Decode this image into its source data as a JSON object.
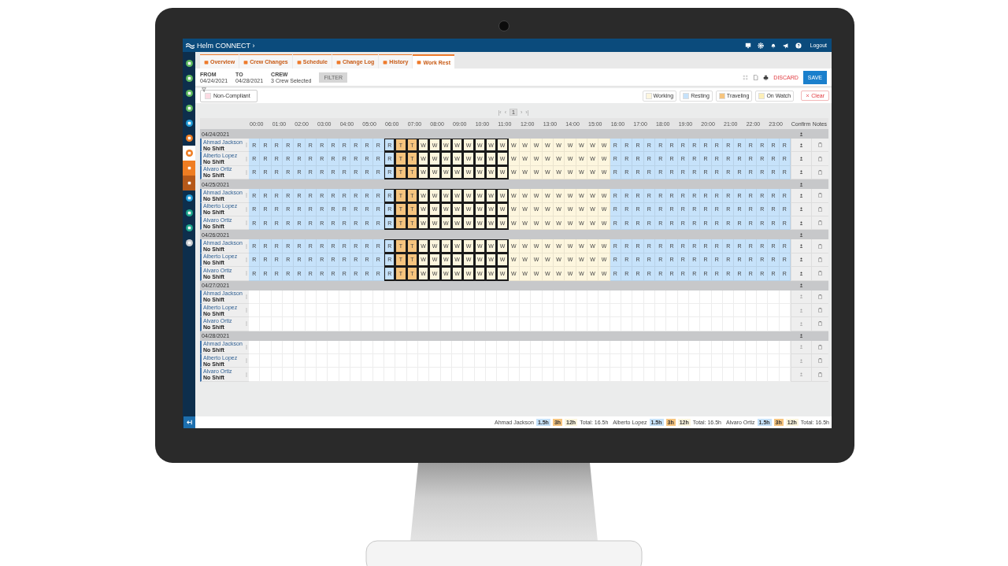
{
  "top_bar": {
    "brand": "Helm **CONNECT** ›",
    "logout": "Logout"
  },
  "sidebar": {
    "items": [
      {
        "color": "#5cb85c",
        "selected": false,
        "kind": "circle"
      },
      {
        "color": "#5cb85c",
        "selected": false,
        "kind": "circle"
      },
      {
        "color": "#5cb85c",
        "selected": false,
        "kind": "circle"
      },
      {
        "color": "#5cb85c",
        "selected": false,
        "kind": "circle"
      },
      {
        "color": "#1e9ad6",
        "selected": false,
        "kind": "circle"
      },
      {
        "color": "#ef7d22",
        "selected": false,
        "kind": "circle"
      },
      {
        "color": "#ef7d22",
        "selected": true,
        "kind": "circle"
      },
      {
        "color": "#ef7d22",
        "selected": false,
        "kind": "tile"
      },
      {
        "color": "#b5591a",
        "selected": false,
        "kind": "tile"
      },
      {
        "color": "#1e9ad6",
        "selected": false,
        "kind": "circle"
      },
      {
        "color": "#1aa58a",
        "selected": false,
        "kind": "circle"
      },
      {
        "color": "#1aa58a",
        "selected": false,
        "kind": "circle"
      },
      {
        "color": "#c9ccd0",
        "selected": false,
        "kind": "circle"
      }
    ]
  },
  "tabs": [
    {
      "label": "Overview",
      "selected": false
    },
    {
      "label": "Crew Changes",
      "selected": false
    },
    {
      "label": "Schedule",
      "selected": false
    },
    {
      "label": "Change Log",
      "selected": false
    },
    {
      "label": "History",
      "selected": false
    },
    {
      "label": "Work Rest",
      "selected": true
    }
  ],
  "filters": {
    "fields": [
      {
        "label": "FROM",
        "value": "04/24/2021"
      },
      {
        "label": "TO",
        "value": "04/28/2021"
      },
      {
        "label": "CREW",
        "value": "3 Crew Selected"
      }
    ],
    "filter_button": {
      "label": "FILTER",
      "disabled": true
    },
    "discard": "DISCARD",
    "save": "SAVE"
  },
  "legend": {
    "non_compliant": "Non-Compliant",
    "items": [
      {
        "label": "Working",
        "color": "#fdf6de"
      },
      {
        "label": "Resting",
        "color": "#c6e2fa"
      },
      {
        "label": "Traveling",
        "color": "#f6c47e"
      },
      {
        "label": "On Watch",
        "color": "#fcefb8"
      }
    ],
    "clear": "Clear"
  },
  "pagination": {
    "first": "|‹",
    "prev": "‹",
    "pages": [
      {
        "label": "1",
        "selected": true
      }
    ],
    "next": "›",
    "last": "›|"
  },
  "grid": {
    "hours": [
      "00:00",
      "01:00",
      "02:00",
      "03:00",
      "04:00",
      "05:00",
      "06:00",
      "07:00",
      "08:00",
      "09:00",
      "10:00",
      "11:00",
      "12:00",
      "13:00",
      "14:00",
      "15:00",
      "16:00",
      "17:00",
      "18:00",
      "19:00",
      "20:00",
      "21:00",
      "22:00",
      "23:00"
    ],
    "confirm": "Confirm",
    "notes": "Notes",
    "days": [
      {
        "date": "04/24/2021",
        "crew": [
          {
            "name": "Ahmad Jackson",
            "shift": "No Shift",
            "confirmable": true,
            "segments": [
              {
                "kind": "resting",
                "outlined": false,
                "cells": [
                  "R",
                  "R",
                  "R",
                  "R",
                  "R",
                  "R",
                  "R",
                  "R",
                  "R",
                  "R",
                  "R",
                  "R"
                ]
              },
              {
                "kind": "resting",
                "outlined": true,
                "cells": [
                  "R"
                ]
              },
              {
                "kind": "traveling",
                "outlined": true,
                "cells": [
                  "T",
                  "T"
                ]
              },
              {
                "kind": "working",
                "outlined": true,
                "cells": [
                  "W",
                  "W",
                  "W",
                  "W",
                  "W",
                  "W",
                  "W",
                  "W"
                ]
              },
              {
                "kind": "working",
                "outlined": false,
                "cells": [
                  "W",
                  "W",
                  "W",
                  "W",
                  "W",
                  "W",
                  "W",
                  "W",
                  "W"
                ]
              },
              {
                "kind": "resting",
                "outlined": false,
                "cells": [
                  "R",
                  "R",
                  "R",
                  "R",
                  "R",
                  "R",
                  "R",
                  "R",
                  "R",
                  "R",
                  "R",
                  "R",
                  "R",
                  "R",
                  "R",
                  "R"
                ]
              }
            ]
          },
          {
            "name": "Alberto Lopez",
            "shift": "No Shift",
            "confirmable": true,
            "segments": [
              {
                "kind": "resting",
                "outlined": false,
                "cells": [
                  "R",
                  "R",
                  "R",
                  "R",
                  "R",
                  "R",
                  "R",
                  "R",
                  "R",
                  "R",
                  "R",
                  "R"
                ]
              },
              {
                "kind": "resting",
                "outlined": true,
                "cells": [
                  "R"
                ]
              },
              {
                "kind": "traveling",
                "outlined": true,
                "cells": [
                  "T",
                  "T"
                ]
              },
              {
                "kind": "working",
                "outlined": true,
                "cells": [
                  "W",
                  "W",
                  "W",
                  "W",
                  "W",
                  "W",
                  "W",
                  "W"
                ]
              },
              {
                "kind": "working",
                "outlined": false,
                "cells": [
                  "W",
                  "W",
                  "W",
                  "W",
                  "W",
                  "W",
                  "W",
                  "W",
                  "W"
                ]
              },
              {
                "kind": "resting",
                "outlined": false,
                "cells": [
                  "R",
                  "R",
                  "R",
                  "R",
                  "R",
                  "R",
                  "R",
                  "R",
                  "R",
                  "R",
                  "R",
                  "R",
                  "R",
                  "R",
                  "R",
                  "R"
                ]
              }
            ]
          },
          {
            "name": "Alvaro Ortiz",
            "shift": "No Shift",
            "confirmable": true,
            "segments": [
              {
                "kind": "resting",
                "outlined": false,
                "cells": [
                  "R",
                  "R",
                  "R",
                  "R",
                  "R",
                  "R",
                  "R",
                  "R",
                  "R",
                  "R",
                  "R",
                  "R"
                ]
              },
              {
                "kind": "resting",
                "outlined": true,
                "cells": [
                  "R"
                ]
              },
              {
                "kind": "traveling",
                "outlined": true,
                "cells": [
                  "T",
                  "T"
                ]
              },
              {
                "kind": "working",
                "outlined": true,
                "cells": [
                  "W",
                  "W",
                  "W",
                  "W",
                  "W",
                  "W",
                  "W",
                  "W"
                ]
              },
              {
                "kind": "working",
                "outlined": false,
                "cells": [
                  "W",
                  "W",
                  "W",
                  "W",
                  "W",
                  "W",
                  "W",
                  "W",
                  "W"
                ]
              },
              {
                "kind": "resting",
                "outlined": false,
                "cells": [
                  "R",
                  "R",
                  "R",
                  "R",
                  "R",
                  "R",
                  "R",
                  "R",
                  "R",
                  "R",
                  "R",
                  "R",
                  "R",
                  "R",
                  "R",
                  "R"
                ]
              }
            ]
          }
        ]
      },
      {
        "date": "04/25/2021",
        "crew": [
          {
            "name": "Ahmad Jackson",
            "shift": "No Shift",
            "confirmable": true,
            "segments": [
              {
                "kind": "resting",
                "outlined": false,
                "cells": [
                  "R",
                  "R",
                  "R",
                  "R",
                  "R",
                  "R",
                  "R",
                  "R",
                  "R",
                  "R",
                  "R",
                  "R"
                ]
              },
              {
                "kind": "resting",
                "outlined": true,
                "cells": [
                  "R"
                ]
              },
              {
                "kind": "traveling",
                "outlined": true,
                "cells": [
                  "T",
                  "T"
                ]
              },
              {
                "kind": "working",
                "outlined": true,
                "cells": [
                  "W",
                  "W",
                  "W",
                  "W",
                  "W",
                  "W",
                  "W",
                  "W"
                ]
              },
              {
                "kind": "working",
                "outlined": false,
                "cells": [
                  "W",
                  "W",
                  "W",
                  "W",
                  "W",
                  "W",
                  "W",
                  "W",
                  "W"
                ]
              },
              {
                "kind": "resting",
                "outlined": false,
                "cells": [
                  "R",
                  "R",
                  "R",
                  "R",
                  "R",
                  "R",
                  "R",
                  "R",
                  "R",
                  "R",
                  "R",
                  "R",
                  "R",
                  "R",
                  "R",
                  "R"
                ]
              }
            ]
          },
          {
            "name": "Alberto Lopez",
            "shift": "No Shift",
            "confirmable": true,
            "segments": [
              {
                "kind": "resting",
                "outlined": false,
                "cells": [
                  "R",
                  "R",
                  "R",
                  "R",
                  "R",
                  "R",
                  "R",
                  "R",
                  "R",
                  "R",
                  "R",
                  "R"
                ]
              },
              {
                "kind": "resting",
                "outlined": true,
                "cells": [
                  "R"
                ]
              },
              {
                "kind": "traveling",
                "outlined": true,
                "cells": [
                  "T",
                  "T"
                ]
              },
              {
                "kind": "working",
                "outlined": true,
                "cells": [
                  "W",
                  "W",
                  "W",
                  "W",
                  "W",
                  "W",
                  "W",
                  "W"
                ]
              },
              {
                "kind": "working",
                "outlined": false,
                "cells": [
                  "W",
                  "W",
                  "W",
                  "W",
                  "W",
                  "W",
                  "W",
                  "W",
                  "W"
                ]
              },
              {
                "kind": "resting",
                "outlined": false,
                "cells": [
                  "R",
                  "R",
                  "R",
                  "R",
                  "R",
                  "R",
                  "R",
                  "R",
                  "R",
                  "R",
                  "R",
                  "R",
                  "R",
                  "R",
                  "R",
                  "R"
                ]
              }
            ]
          },
          {
            "name": "Alvaro Ortiz",
            "shift": "No Shift",
            "confirmable": true,
            "segments": [
              {
                "kind": "resting",
                "outlined": false,
                "cells": [
                  "R",
                  "R",
                  "R",
                  "R",
                  "R",
                  "R",
                  "R",
                  "R",
                  "R",
                  "R",
                  "R",
                  "R"
                ]
              },
              {
                "kind": "resting",
                "outlined": true,
                "cells": [
                  "R"
                ]
              },
              {
                "kind": "traveling",
                "outlined": true,
                "cells": [
                  "T",
                  "T"
                ]
              },
              {
                "kind": "working",
                "outlined": true,
                "cells": [
                  "W",
                  "W",
                  "W",
                  "W",
                  "W",
                  "W",
                  "W",
                  "W"
                ]
              },
              {
                "kind": "working",
                "outlined": false,
                "cells": [
                  "W",
                  "W",
                  "W",
                  "W",
                  "W",
                  "W",
                  "W",
                  "W",
                  "W"
                ]
              },
              {
                "kind": "resting",
                "outlined": false,
                "cells": [
                  "R",
                  "R",
                  "R",
                  "R",
                  "R",
                  "R",
                  "R",
                  "R",
                  "R",
                  "R",
                  "R",
                  "R",
                  "R",
                  "R",
                  "R",
                  "R"
                ]
              }
            ]
          }
        ]
      },
      {
        "date": "04/26/2021",
        "crew": [
          {
            "name": "Ahmad Jackson",
            "shift": "No Shift",
            "confirmable": true,
            "segments": [
              {
                "kind": "resting",
                "outlined": false,
                "cells": [
                  "R",
                  "R",
                  "R",
                  "R",
                  "R",
                  "R",
                  "R",
                  "R",
                  "R",
                  "R",
                  "R",
                  "R"
                ]
              },
              {
                "kind": "resting",
                "outlined": true,
                "cells": [
                  "R"
                ]
              },
              {
                "kind": "traveling",
                "outlined": true,
                "cells": [
                  "T",
                  "T"
                ]
              },
              {
                "kind": "working",
                "outlined": true,
                "cells": [
                  "W",
                  "W",
                  "W",
                  "W",
                  "W",
                  "W",
                  "W",
                  "W"
                ]
              },
              {
                "kind": "working",
                "outlined": false,
                "cells": [
                  "W",
                  "W",
                  "W",
                  "W",
                  "W",
                  "W",
                  "W",
                  "W",
                  "W"
                ]
              },
              {
                "kind": "resting",
                "outlined": false,
                "cells": [
                  "R",
                  "R",
                  "R",
                  "R",
                  "R",
                  "R",
                  "R",
                  "R",
                  "R",
                  "R",
                  "R",
                  "R",
                  "R",
                  "R",
                  "R",
                  "R"
                ]
              }
            ]
          },
          {
            "name": "Alberto Lopez",
            "shift": "No Shift",
            "confirmable": true,
            "segments": [
              {
                "kind": "resting",
                "outlined": false,
                "cells": [
                  "R",
                  "R",
                  "R",
                  "R",
                  "R",
                  "R",
                  "R",
                  "R",
                  "R",
                  "R",
                  "R",
                  "R"
                ]
              },
              {
                "kind": "resting",
                "outlined": true,
                "cells": [
                  "R"
                ]
              },
              {
                "kind": "traveling",
                "outlined": true,
                "cells": [
                  "T",
                  "T"
                ]
              },
              {
                "kind": "working",
                "outlined": true,
                "cells": [
                  "W",
                  "W",
                  "W",
                  "W",
                  "W",
                  "W",
                  "W",
                  "W"
                ]
              },
              {
                "kind": "working",
                "outlined": false,
                "cells": [
                  "W",
                  "W",
                  "W",
                  "W",
                  "W",
                  "W",
                  "W",
                  "W",
                  "W"
                ]
              },
              {
                "kind": "resting",
                "outlined": false,
                "cells": [
                  "R",
                  "R",
                  "R",
                  "R",
                  "R",
                  "R",
                  "R",
                  "R",
                  "R",
                  "R",
                  "R",
                  "R",
                  "R",
                  "R",
                  "R",
                  "R"
                ]
              }
            ]
          },
          {
            "name": "Alvaro Ortiz",
            "shift": "No Shift",
            "confirmable": true,
            "segments": [
              {
                "kind": "resting",
                "outlined": false,
                "cells": [
                  "R",
                  "R",
                  "R",
                  "R",
                  "R",
                  "R",
                  "R",
                  "R",
                  "R",
                  "R",
                  "R",
                  "R"
                ]
              },
              {
                "kind": "resting",
                "outlined": true,
                "cells": [
                  "R"
                ]
              },
              {
                "kind": "traveling",
                "outlined": true,
                "cells": [
                  "T",
                  "T"
                ]
              },
              {
                "kind": "working",
                "outlined": true,
                "cells": [
                  "W",
                  "W",
                  "W",
                  "W",
                  "W",
                  "W",
                  "W",
                  "W"
                ]
              },
              {
                "kind": "working",
                "outlined": false,
                "cells": [
                  "W",
                  "W",
                  "W",
                  "W",
                  "W",
                  "W",
                  "W",
                  "W",
                  "W"
                ]
              },
              {
                "kind": "resting",
                "outlined": false,
                "cells": [
                  "R",
                  "R",
                  "R",
                  "R",
                  "R",
                  "R",
                  "R",
                  "R",
                  "R",
                  "R",
                  "R",
                  "R",
                  "R",
                  "R",
                  "R",
                  "R"
                ]
              }
            ]
          }
        ]
      },
      {
        "date": "04/27/2021",
        "crew": [
          {
            "name": "Ahmad Jackson",
            "shift": "No Shift",
            "confirmable": false
          },
          {
            "name": "Alberto Lopez",
            "shift": "No Shift",
            "confirmable": false
          },
          {
            "name": "Alvaro Ortiz",
            "shift": "No Shift",
            "confirmable": false
          }
        ]
      },
      {
        "date": "04/28/2021",
        "crew": [
          {
            "name": "Ahmad Jackson",
            "shift": "No Shift",
            "confirmable": false
          },
          {
            "name": "Alberto Lopez",
            "shift": "No Shift",
            "confirmable": false
          },
          {
            "name": "Alvaro Ortiz",
            "shift": "No Shift",
            "confirmable": false
          }
        ]
      }
    ]
  },
  "footer": {
    "totals": [
      {
        "name": "Ahmad Jackson",
        "chips": [
          {
            "kind": "resting",
            "text": "1.5h"
          },
          {
            "kind": "traveling",
            "text": "3h"
          },
          {
            "kind": "working",
            "text": "12h"
          }
        ],
        "total": "Total: 16.5h"
      },
      {
        "name": "Alberto Lopez",
        "chips": [
          {
            "kind": "resting",
            "text": "1.5h"
          },
          {
            "kind": "traveling",
            "text": "3h"
          },
          {
            "kind": "working",
            "text": "12h"
          }
        ],
        "total": "Total: 16.5h"
      },
      {
        "name": "Alvaro Ortiz",
        "chips": [
          {
            "kind": "resting",
            "text": "1.5h"
          },
          {
            "kind": "traveling",
            "text": "3h"
          },
          {
            "kind": "working",
            "text": "12h"
          }
        ],
        "total": "Total: 16.5h"
      }
    ]
  }
}
